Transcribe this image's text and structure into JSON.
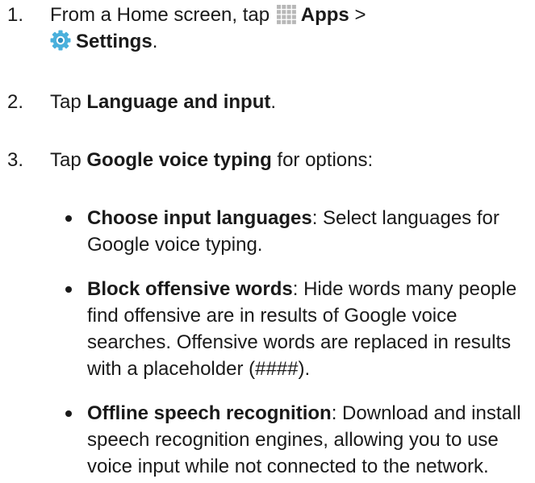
{
  "steps": [
    {
      "number": "1.",
      "line1_prefix": "From a Home screen, tap",
      "apps_label": "Apps",
      "separator": " >",
      "settings_label": "Settings",
      "suffix": "."
    },
    {
      "number": "2.",
      "prefix": "Tap ",
      "bold": "Language and input",
      "suffix": "."
    },
    {
      "number": "3.",
      "prefix": "Tap ",
      "bold": "Google voice typing",
      "suffix": " for options:",
      "options": [
        {
          "title": "Choose input languages",
          "text": ": Select languages for Google voice typing."
        },
        {
          "title": "Block offensive words",
          "text": ": Hide words many people find offensive are in results of Google voice searches. Offensive words are replaced in results with a placeholder (####)."
        },
        {
          "title": "Offline speech recognition",
          "text": ": Download and install speech recognition engines, allowing you to use voice input while not connected to the network."
        }
      ]
    }
  ],
  "icons": {
    "apps": "apps-grid-icon",
    "settings": "settings-gear-icon"
  },
  "colors": {
    "text": "#1a1a1a",
    "apps_icon": "#b8b8b8",
    "settings_icon": "#4ab0dc"
  }
}
